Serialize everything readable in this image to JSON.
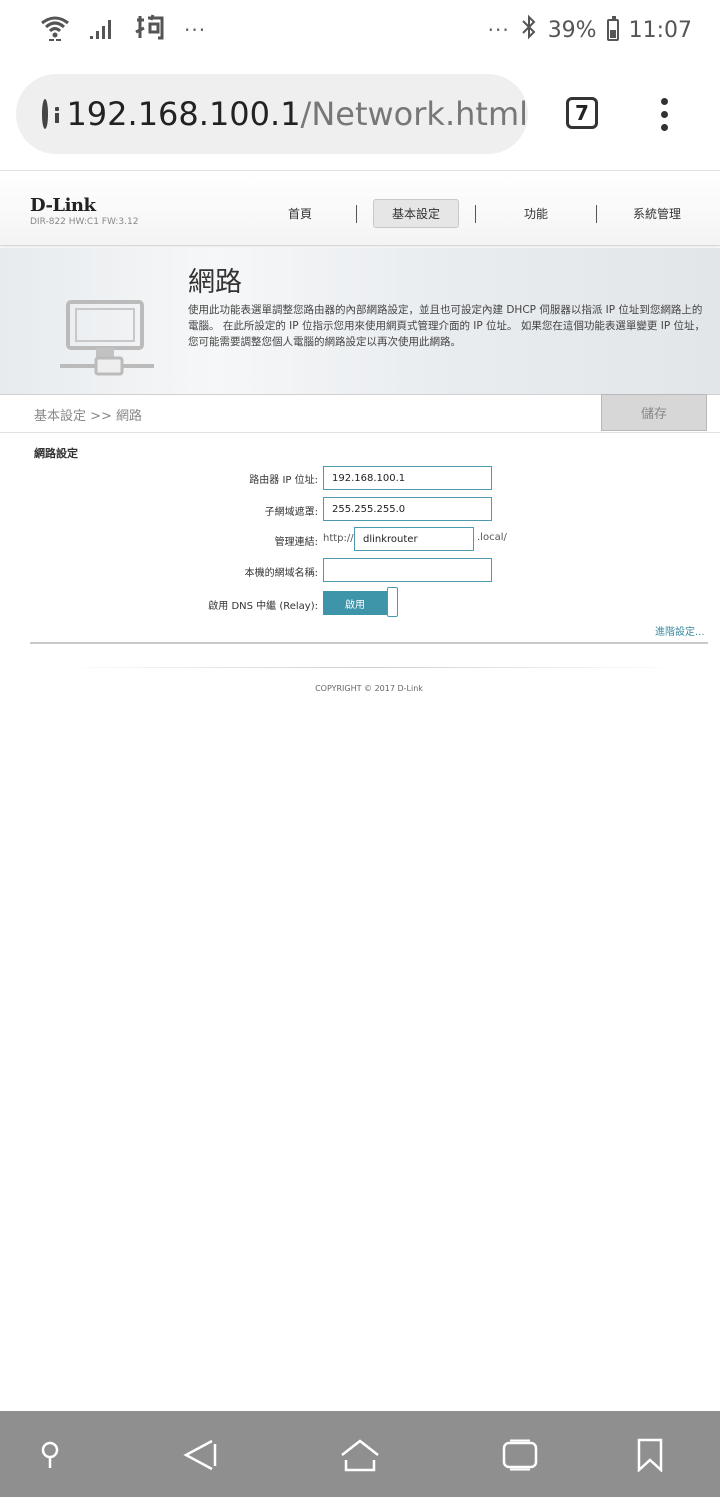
{
  "status_bar": {
    "left_dots": "···",
    "right_dots": "···",
    "battery": "39%",
    "time": "11:07",
    "icons": [
      "wifi-icon",
      "signal-icon",
      "carrier-icon",
      "bluetooth-icon",
      "battery-icon"
    ]
  },
  "browser": {
    "url_host": "192.168.100.1",
    "url_path": "/Network.html",
    "tab_count": "7",
    "icons": [
      "info-icon",
      "menu-icon"
    ]
  },
  "router": {
    "logo": "D-Link",
    "model": "DIR-822 HW:C1 FW:3.12",
    "nav": [
      {
        "label": "首頁"
      },
      {
        "label": "基本設定",
        "active": true
      },
      {
        "label": "功能"
      },
      {
        "label": "系統管理"
      }
    ]
  },
  "hero": {
    "title": "網路",
    "description": "使用此功能表選單調整您路由器的內部網路設定，並且也可設定內建 DHCP 伺服器以指派 IP 位址到您網路上的電腦。 在此所設定的 IP 位指示您用來使用網頁式管理介面的 IP 位址。 如果您在這個功能表選單變更 IP 位址，您可能需要調整您個人電腦的網路設定以再次使用此網路。"
  },
  "breadcrumb": "基本設定 >> 網路",
  "save_label": "儲存",
  "form": {
    "section_title": "網路設定",
    "router_ip_label": "路由器 IP 位址:",
    "router_ip_value": "192.168.100.1",
    "subnet_label": "子網域遮罩:",
    "subnet_value": "255.255.255.0",
    "mgmt_link_label": "管理連結:",
    "mgmt_prefix": "http://",
    "mgmt_value": "dlinkrouter",
    "mgmt_suffix": ".local/",
    "domain_label": "本機的網域名稱:",
    "domain_value": "",
    "dns_relay_label": "啟用 DNS 中繼 (Relay):",
    "dns_relay_state": "啟用",
    "advanced_link": "進階設定..."
  },
  "footer": {
    "copyright": "COPYRIGHT © 2017 D-Link"
  },
  "bottom_nav": {
    "icons": [
      "pin-icon",
      "back-icon",
      "home-icon",
      "recents-icon",
      "bookmark-icon"
    ]
  }
}
